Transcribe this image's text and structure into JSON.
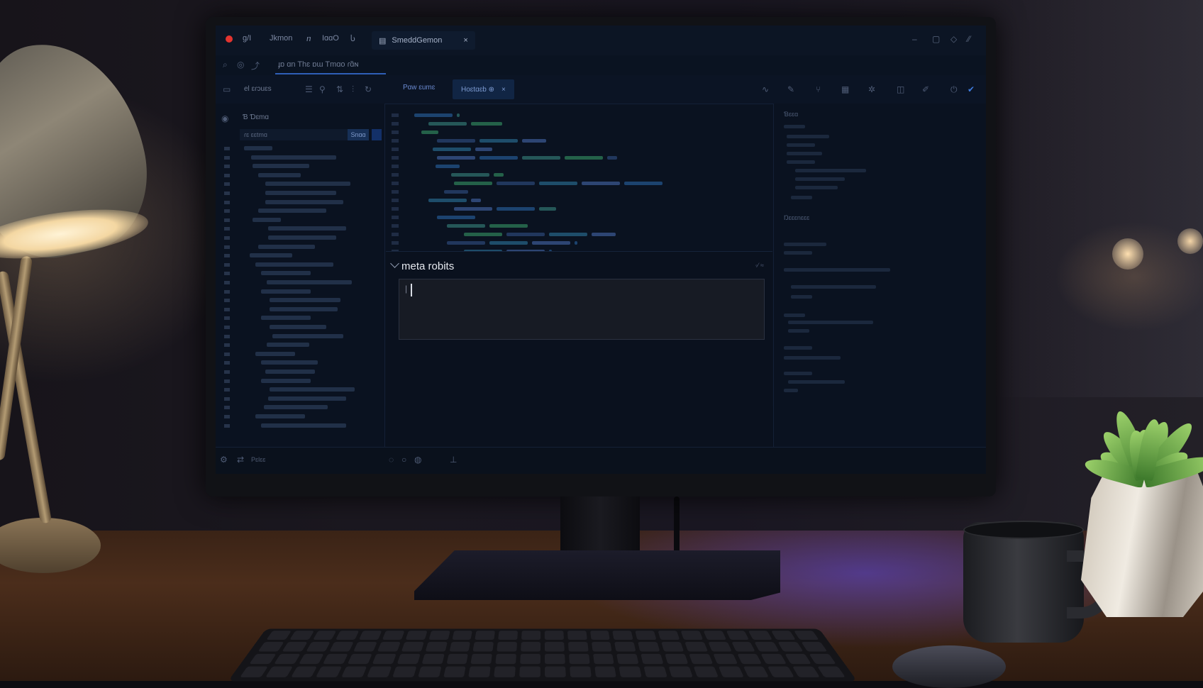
{
  "scene": {
    "accent_blue": "#2f5fb8",
    "lamp_light": "#fff3d6",
    "desk_light": "#5a46e6"
  },
  "titlebar": {
    "menu_items": [
      "ɡ/I",
      "Jkmon",
      "ⴖ",
      "IɑɑO",
      "Ⴑ"
    ],
    "active_tab": "SmeddGemon",
    "tab_close": "×",
    "window_controls": [
      "–",
      "▢",
      "◇",
      "⁄⁄"
    ]
  },
  "urlbar": {
    "text": "ɟɒ ɑn Thɛ  ɒɯ Tmɑo  ɾɑ̃ɴ"
  },
  "toolbar": {
    "left_text": "el  ɛɾɔuɛs",
    "editor_tab_1": "Pɑw ɛumɛ",
    "editor_tab_2": "Hoɛtɑɛb ⊕",
    "editor_tab_close": "×"
  },
  "sidebar": {
    "header": "Ɓ  Ɗɛmɑ",
    "filter_placeholder": "ɾɛ ɛɛtmɑ",
    "filter_button": "Snɑɑ"
  },
  "panel": {
    "title": "meta robits",
    "input_value": "|",
    "action_hint": "◦⁄ ≈"
  },
  "rpanel": {
    "section_1": "Ɓɛɛɑ",
    "section_2": "Ŋɛɛɛnɛɛɛ"
  },
  "status": {
    "left_label": "Pɛlɛɛ"
  }
}
